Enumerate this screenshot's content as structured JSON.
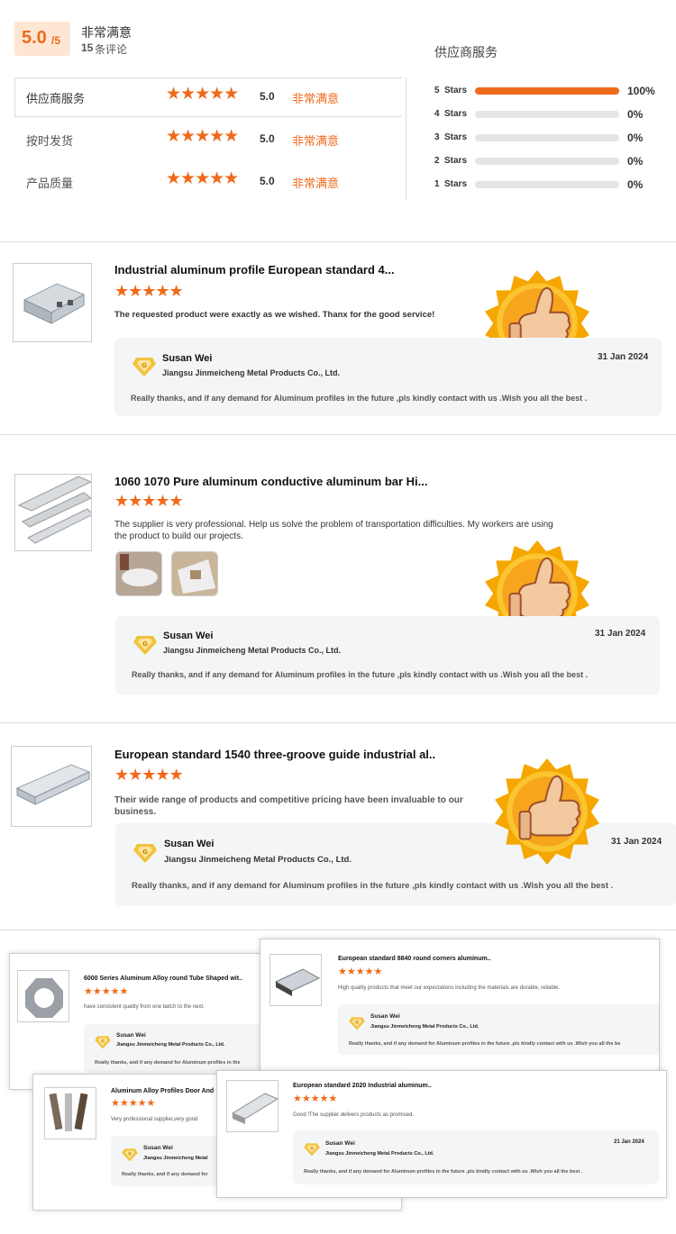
{
  "summary": {
    "score": "5.0",
    "out_of": "/5",
    "label": "非常满意",
    "count": "15",
    "count_unit": "条评论"
  },
  "ratings": [
    {
      "label": "供应商服务",
      "score": "5.0",
      "text": "非常满意"
    },
    {
      "label": "按时发货",
      "score": "5.0",
      "text": "非常满意"
    },
    {
      "label": "产品质量",
      "score": "5.0",
      "text": "非常满意"
    }
  ],
  "dist_title": "供应商服务",
  "distribution": [
    {
      "stars": "5",
      "label": "Stars",
      "pct": "100%",
      "value": 1.0
    },
    {
      "stars": "4",
      "label": "Stars",
      "pct": "0%",
      "value": 0
    },
    {
      "stars": "3",
      "label": "Stars",
      "pct": "0%",
      "value": 0
    },
    {
      "stars": "2",
      "label": "Stars",
      "pct": "0%",
      "value": 0
    },
    {
      "stars": "1",
      "label": "Stars",
      "pct": "0%",
      "value": 0
    }
  ],
  "colors": {
    "accent": "#f06a1a",
    "bar_bg": "#e5e5e5",
    "reply_bg": "#f4f5f7"
  },
  "star_glyph": "★★★★★",
  "reviews": [
    {
      "title": "Industrial aluminum profile European standard 4...",
      "text": "The requested product were exactly as we wished. Thanx for the good service!",
      "reply_name": "Susan Wei",
      "reply_company": "Jiangsu Jinmeicheng Metal Products Co., Ltd.",
      "reply_date": "31 Jan 2024",
      "reply_text": "Really thanks, and if any demand for  Aluminum profiles in the future ,pls  kindly contact with us .Wish you all the best ."
    },
    {
      "title": "1060 1070 Pure aluminum conductive aluminum bar Hi...",
      "text": "The supplier is very professional. Help us solve the problem of transportation difficulties. My workers are using the product to build our projects.",
      "reply_name": "Susan Wei",
      "reply_company": "Jiangsu Jinmeicheng Metal Products Co., Ltd.",
      "reply_date": "31 Jan 2024",
      "reply_text": "Really thanks, and if any demand for  Aluminum profiles in the future ,pls  kindly contact with us .Wish you all the best ."
    },
    {
      "title": "European standard 1540 three-groove guide industrial al..",
      "text": "Their wide range of products and competitive pricing have been invaluable to our business.",
      "reply_name": "Susan Wei",
      "reply_company": "Jiangsu Jinmeicheng Metal Products Co., Ltd.",
      "reply_date": "31 Jan 2024",
      "reply_text": "Really thanks, and if any demand for  Aluminum profiles in the future ,pls  kindly contact with us .Wish you all the best ."
    }
  ],
  "collage": [
    {
      "title": "6000 Series Aluminum Alloy round Tube Shaped wit..",
      "text": "have consistent quality from one batch to the next.",
      "reply_name": "Susan Wei",
      "reply_company": "Jiangsu Jinmeicheng Metal Products Co., Ltd.",
      "reply_text": "Really thanks, and if any demand for  Aluminum profiles in the"
    },
    {
      "title": "European standard 8840 round corners aluminum..",
      "text": "High quality products that meet our expectations including the materials are durable, reliable.",
      "reply_name": "Susan Wei",
      "reply_company": "Jiangsu Jinmeicheng Metal Products Co., Ltd.",
      "reply_text": "Really thanks, and if any demand for  Aluminum profiles in the future ,pls  kindly contact with us .Wish you all the be"
    },
    {
      "title": "Aluminum Alloy Profiles Door And",
      "text": "Very professional supplier,very good",
      "reply_name": "Susan Wei",
      "reply_company": "Jiangsu Jinmeicheng Metal",
      "reply_text": "Really thanks, and if any demand for"
    },
    {
      "title": "European standard 2020 Industrial aluminum..",
      "text": "Good !The supplier delivers products as promised.",
      "reply_name": "Susan Wei",
      "reply_company": "Jiangsu Jinmeicheng Metal Products Co., Ltd.",
      "reply_date": "21 Jan 2024",
      "reply_text": "Really thanks, and if any demand for  Aluminum profiles in the future ,pls  kindly contact with us .Wish you all the best ."
    }
  ]
}
